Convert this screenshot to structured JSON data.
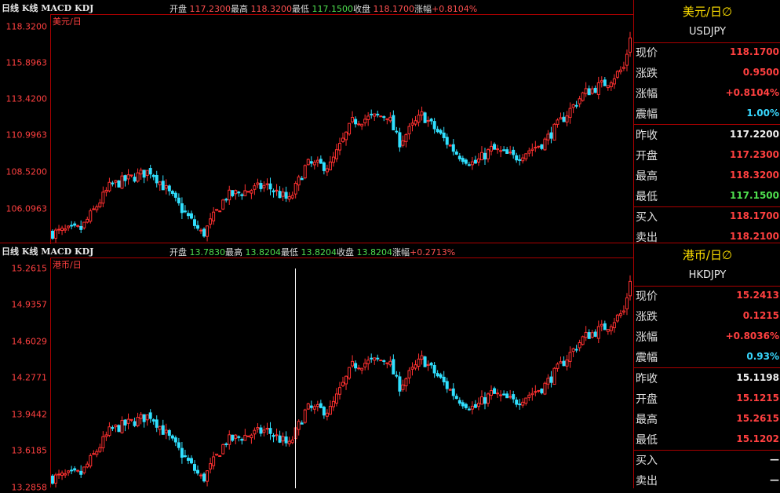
{
  "panels": [
    {
      "period_label": "日线 K线 MACD KDJ",
      "instrument_label": "美元/日",
      "quote": {
        "open_label": "开盘",
        "open": "117.2300",
        "high_label": "最高",
        "high": "118.3200",
        "low_label": "最低",
        "low": "117.1500",
        "close_label": "收盘",
        "close": "118.1700",
        "change_label": "涨幅",
        "change": "+0.8104%"
      },
      "yticks": [
        "118.3200",
        "115.8963",
        "113.4200",
        "110.9963",
        "108.5200",
        "106.0963"
      ],
      "ylim": [
        103.5,
        118.8
      ],
      "side": {
        "title": "美元/日",
        "code": "USDJPY",
        "rows1": [
          {
            "label": "现价",
            "value": "118.1700"
          },
          {
            "label": "涨跌",
            "value": "0.9500"
          },
          {
            "label": "涨幅",
            "value": "+0.8104%"
          },
          {
            "label": "震幅",
            "value": "1.00%"
          }
        ],
        "rows2": [
          {
            "label": "昨收",
            "value": "117.2200"
          },
          {
            "label": "开盘",
            "value": "117.2300"
          },
          {
            "label": "最高",
            "value": "118.3200"
          },
          {
            "label": "最低",
            "value": "117.1500"
          }
        ],
        "rows3": [
          {
            "label": "买入",
            "value": "118.1700"
          },
          {
            "label": "卖出",
            "value": "118.2100"
          }
        ]
      }
    },
    {
      "period_label": "日线 K线 MACD KDJ",
      "instrument_label": "港币/日",
      "quote": {
        "open_label": "开盘",
        "open": "13.7830",
        "high_label": "最高",
        "high": "13.8204",
        "low_label": "最低",
        "low": "13.8204",
        "close_label": "收盘",
        "close": "13.8204",
        "change_label": "涨幅",
        "change": "+0.2713%"
      },
      "yticks": [
        "15.2615",
        "14.9357",
        "14.6029",
        "14.2771",
        "13.9442",
        "13.6185",
        "13.2858"
      ],
      "ylim": [
        13.2858,
        15.2615
      ],
      "side": {
        "title": "港币/日",
        "code": "HKDJPY",
        "rows1": [
          {
            "label": "现价",
            "value": "15.2413"
          },
          {
            "label": "涨跌",
            "value": "0.1215"
          },
          {
            "label": "涨幅",
            "value": "+0.8036%"
          },
          {
            "label": "震幅",
            "value": "0.93%"
          }
        ],
        "rows2": [
          {
            "label": "昨收",
            "value": "15.1198"
          },
          {
            "label": "开盘",
            "value": "15.1215"
          },
          {
            "label": "最高",
            "value": "15.2615"
          },
          {
            "label": "最低",
            "value": "15.1202"
          }
        ],
        "rows3": [
          {
            "label": "买入",
            "value": "—"
          },
          {
            "label": "卖出",
            "value": "—"
          }
        ]
      }
    }
  ],
  "colors": {
    "up": "#ff3030",
    "down": "#30e0ff",
    "axis": "#aa0000"
  },
  "icons": {
    "title_icon": "circle-slash-icon"
  }
}
